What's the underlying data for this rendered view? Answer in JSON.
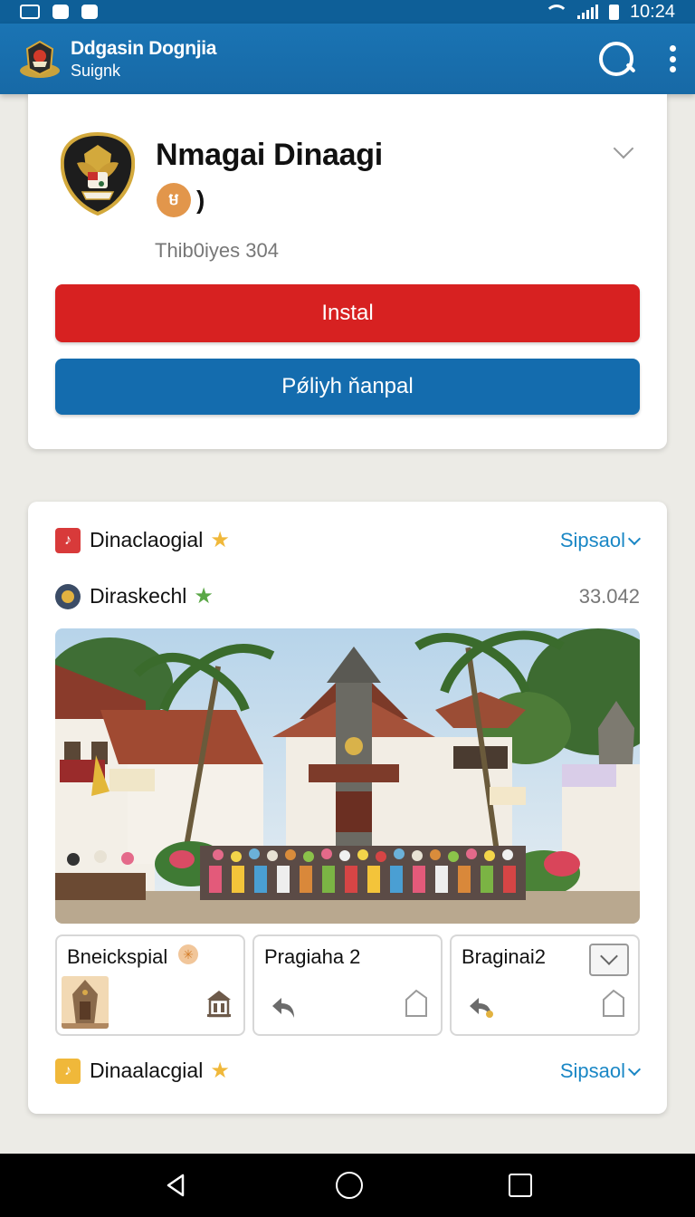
{
  "status_bar": {
    "time": "10:24",
    "icons": [
      "notification-icon",
      "image-icon",
      "camera-icon",
      "wifi-icon",
      "signal-icon",
      "battery-icon"
    ]
  },
  "app_bar": {
    "title": "Ddgasin Dognjia",
    "subtitle": "Suignk",
    "icons": [
      "emblem-logo",
      "search-icon",
      "more-vert-icon"
    ]
  },
  "app_card": {
    "name": "Nmagai Dinaagi",
    "rating_badge": "ម",
    "rating_paren": ")",
    "downloads": "Thib0iyes 304",
    "install_label": "Instal",
    "open_label": "Pǿliyh ňanpal"
  },
  "details_card": {
    "row1": {
      "label": "Dinaclaogial",
      "link": "Sipsaol"
    },
    "row2": {
      "label": "Diraskechl",
      "value": "33.042"
    },
    "tiles": [
      {
        "label": "Bneickspial",
        "badge": "✳"
      },
      {
        "label": "Pragiaha 2"
      },
      {
        "label": "Braginai2"
      }
    ],
    "row3": {
      "label": "Dinaalacgial",
      "link": "Sipsaol"
    }
  },
  "colors": {
    "app_bar": "#1a72b1",
    "install_button": "#d72121",
    "open_button": "#146cae",
    "link": "#1a87c5"
  },
  "nav_bar": {
    "icons": [
      "back-icon",
      "home-icon",
      "recents-icon"
    ]
  }
}
